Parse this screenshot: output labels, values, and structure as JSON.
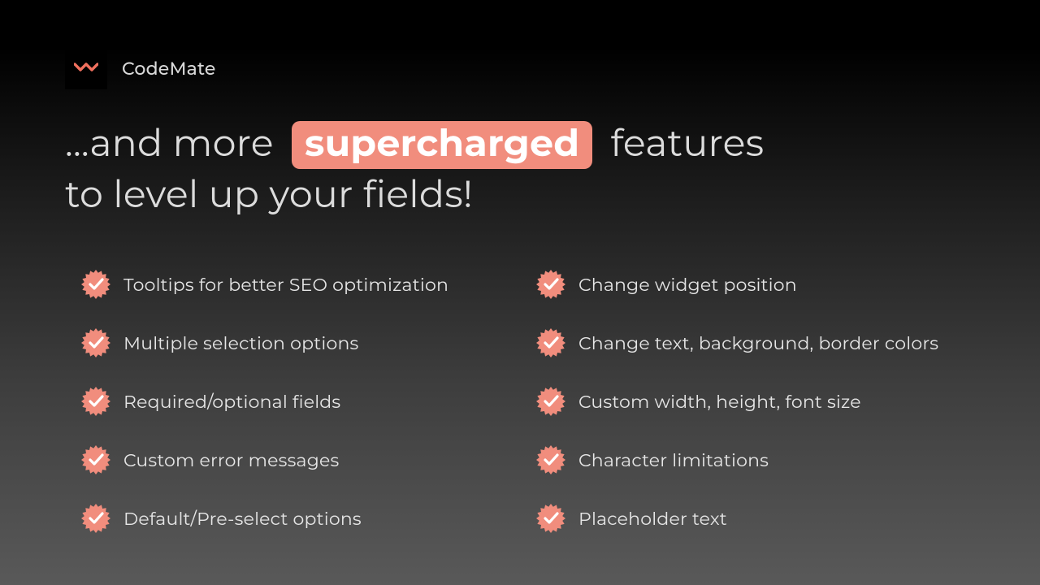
{
  "brand": {
    "name": "CodeMate",
    "accent": "#f18d7d"
  },
  "headline": {
    "pre": "...and more",
    "highlight": "supercharged",
    "post": "features",
    "line2": "to level up your fields!"
  },
  "features": {
    "left": [
      "Tooltips for better SEO optimization",
      "Multiple selection options",
      "Required/optional fields",
      "Custom error messages",
      "Default/Pre-select options"
    ],
    "right": [
      "Change widget position",
      "Change text, background, border colors",
      "Custom width, height, font size",
      "Character limitations",
      "Placeholder text"
    ]
  }
}
